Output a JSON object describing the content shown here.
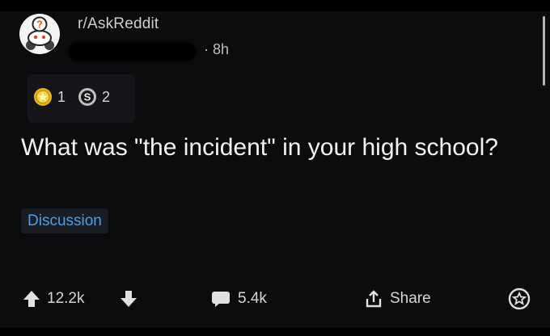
{
  "post": {
    "subreddit": "r/AskReddit",
    "time": "· 8h",
    "awards": [
      {
        "icon": "gold-award-icon",
        "count": "1"
      },
      {
        "icon": "silver-award-icon",
        "count": "2"
      }
    ],
    "title": "What was \"the incident\" in your high school?",
    "flair": "Discussion"
  },
  "actions": {
    "score": "12.2k",
    "comments": "5.4k",
    "share_label": "Share"
  },
  "colors": {
    "background": "#0c0c0e",
    "flair_text": "#4f9ee6",
    "gold": "#e8b820",
    "silver": "#c0c0c0"
  }
}
